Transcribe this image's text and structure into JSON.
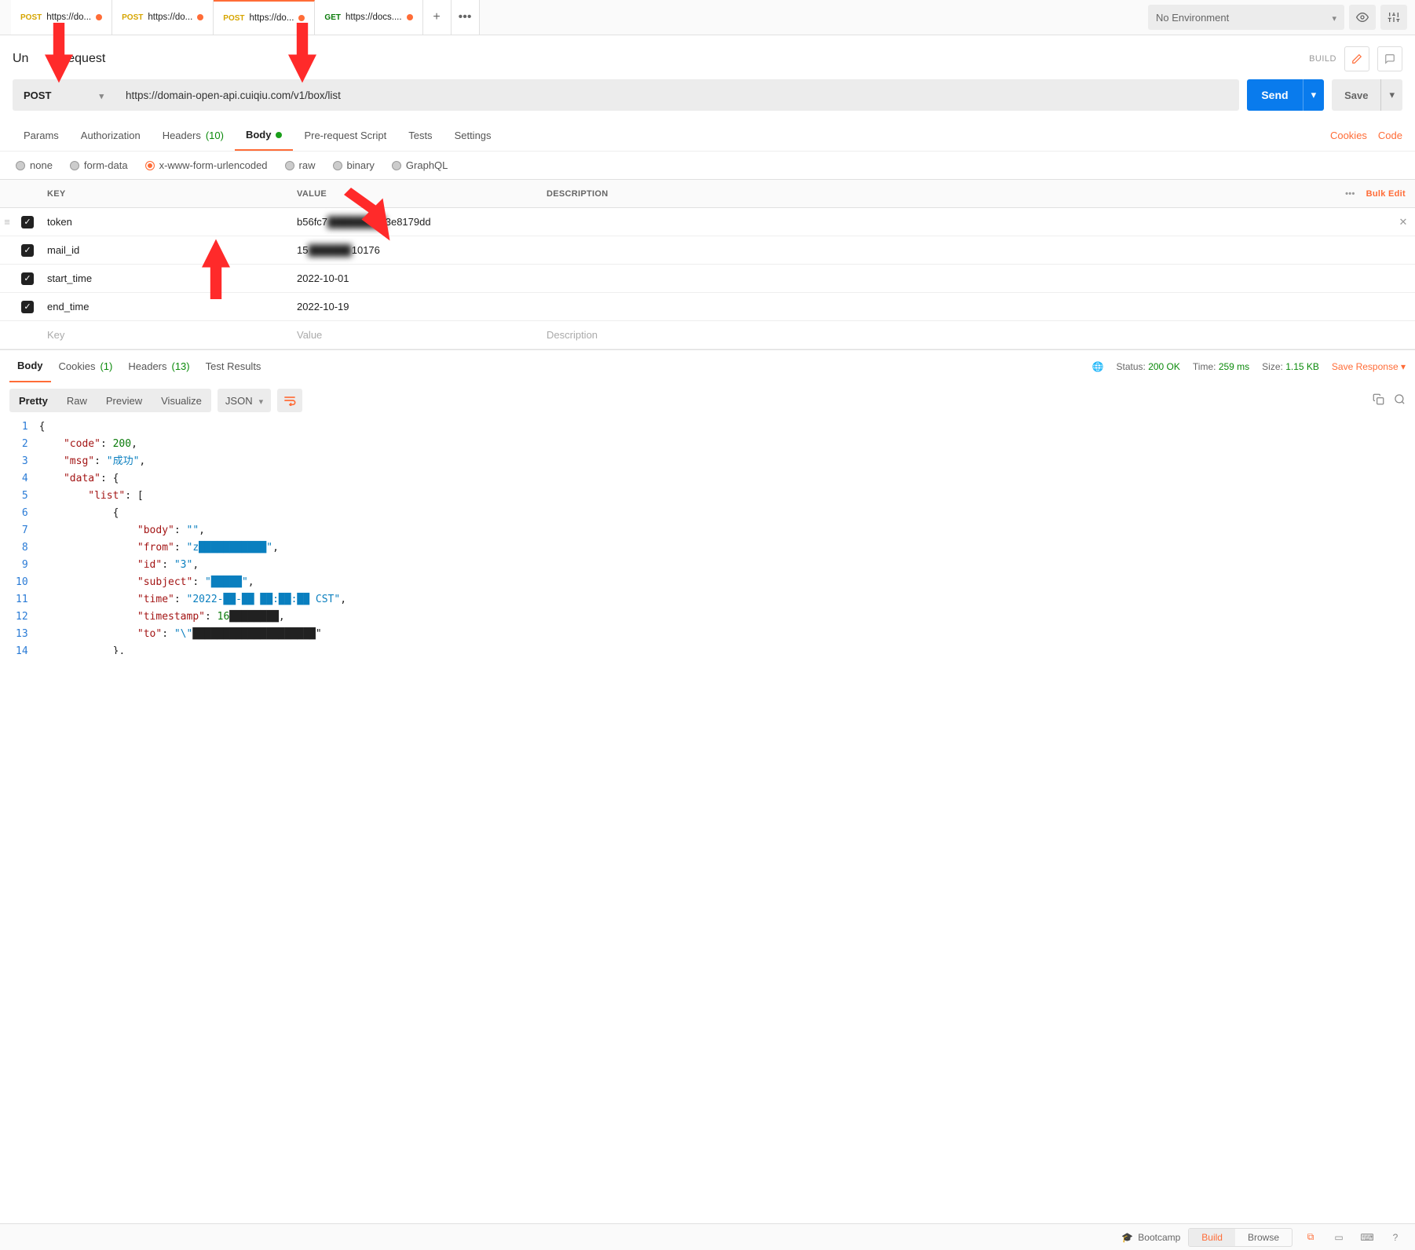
{
  "topbar": {
    "tabs": [
      {
        "method": "POST",
        "label": "https://do...",
        "modified": true
      },
      {
        "method": "POST",
        "label": "https://do...",
        "modified": true
      },
      {
        "method": "POST",
        "label": "https://do...",
        "modified": true,
        "active": true
      },
      {
        "method": "GET",
        "label": "https://docs....",
        "modified": true
      }
    ],
    "env_label": "No Environment"
  },
  "request": {
    "title_prefix": "Un",
    "title_suffix": "equest",
    "build": "BUILD",
    "method": "POST",
    "url": "https://domain-open-api.cuiqiu.com/v1/box/list",
    "send": "Send",
    "save": "Save"
  },
  "reqtabs": {
    "params": "Params",
    "auth": "Authorization",
    "headers": "Headers",
    "headers_count": "(10)",
    "body": "Body",
    "prerequest": "Pre-request Script",
    "tests": "Tests",
    "settings": "Settings",
    "cookies": "Cookies",
    "code": "Code"
  },
  "bodytypes": {
    "none": "none",
    "formdata": "form-data",
    "xwww": "x-www-form-urlencoded",
    "raw": "raw",
    "binary": "binary",
    "graphql": "GraphQL"
  },
  "kv": {
    "key_h": "KEY",
    "value_h": "VALUE",
    "desc_h": "DESCRIPTION",
    "bulk": "Bulk Edit",
    "rows": [
      {
        "key": "token",
        "value_pre": "b56fc7",
        "value_blur": "████████",
        "value_post": "3e8179dd"
      },
      {
        "key": "mail_id",
        "value_pre": "15",
        "value_blur": "██████",
        "value_post": "10176"
      },
      {
        "key": "start_time",
        "value_pre": "2022-10-01",
        "value_blur": "",
        "value_post": ""
      },
      {
        "key": "end_time",
        "value_pre": "2022-10-19",
        "value_blur": "",
        "value_post": ""
      }
    ],
    "ph_key": "Key",
    "ph_value": "Value",
    "ph_desc": "Description"
  },
  "resp": {
    "body": "Body",
    "cookies": "Cookies",
    "cookies_count": "(1)",
    "headers": "Headers",
    "headers_count": "(13)",
    "tests": "Test Results",
    "status_lbl": "Status:",
    "status_val": "200 OK",
    "time_lbl": "Time:",
    "time_val": "259 ms",
    "size_lbl": "Size:",
    "size_val": "1.15 KB",
    "save_resp": "Save Response",
    "pretty": "Pretty",
    "raw": "Raw",
    "preview": "Preview",
    "visualize": "Visualize",
    "format": "JSON"
  },
  "json_lines": [
    "{",
    "    \"code\": 200,",
    "    \"msg\": \"成功\",",
    "    \"data\": {",
    "        \"list\": [",
    "            {",
    "                \"body\": \"\",",
    "                \"from\": \"z███████████\",",
    "                \"id\": \"3\",",
    "                \"subject\": \"█████\",",
    "                \"time\": \"2022-██-██ ██:██:██ CST\",",
    "                \"timestamp\": 16████████,",
    "                \"to\": \"\\\"████████████████████\"",
    "            },",
    ""
  ],
  "footer": {
    "bootcamp": "Bootcamp",
    "build": "Build",
    "browse": "Browse"
  }
}
